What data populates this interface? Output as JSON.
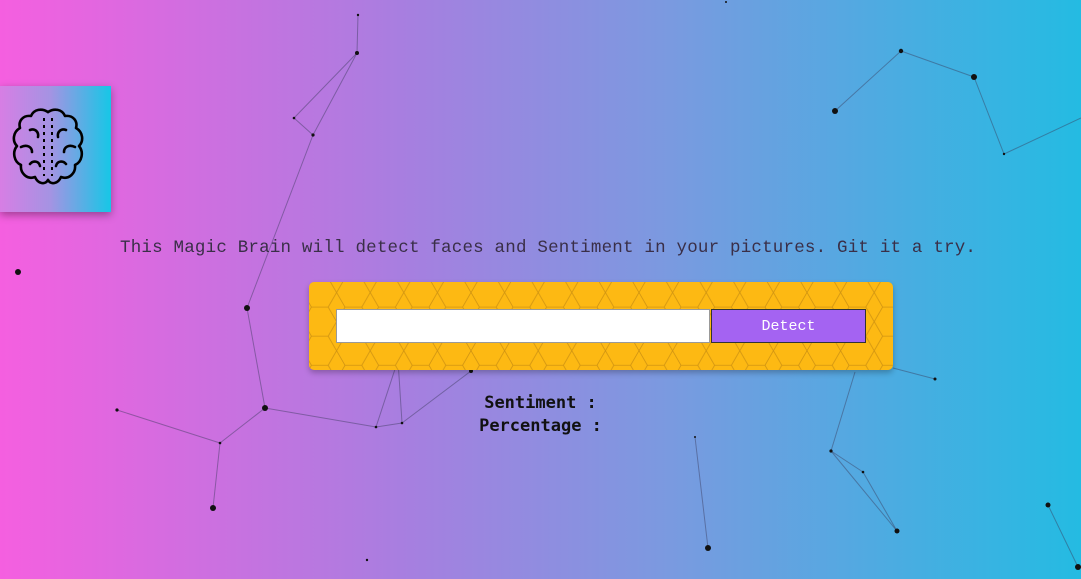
{
  "logo": {
    "icon": "brain-icon"
  },
  "intro": {
    "text": "This Magic Brain will detect faces and Sentiment in your pictures. Git it a try."
  },
  "form": {
    "input_value": "",
    "input_placeholder": "",
    "button_label": "Detect"
  },
  "results": {
    "sentiment_label": "Sentiment :",
    "percentage_label": "Percentage :"
  },
  "colors": {
    "gradient_left": "#f55fe0",
    "gradient_right": "#24bbe2",
    "form_bg": "#fdb913",
    "button_bg": "#a463f2"
  }
}
